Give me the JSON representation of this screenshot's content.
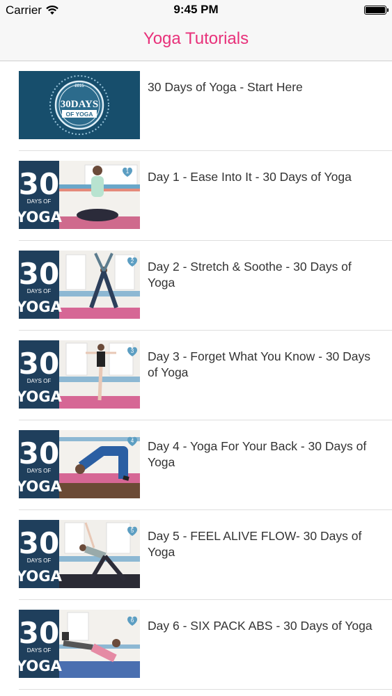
{
  "status_bar": {
    "carrier": "Carrier",
    "time": "9:45 PM"
  },
  "nav": {
    "title": "Yoga Tutorials"
  },
  "rows": [
    {
      "label": "30 Days of Yoga - Start Here",
      "thumbnail": {
        "kind": "badge",
        "badge_top": "30DAYS",
        "badge_bottom": "OF YOGA",
        "badge_year": "2015"
      }
    },
    {
      "label": "Day 1 - Ease Into It - 30 Days of Yoga",
      "thumbnail": {
        "kind": "day",
        "big": "30",
        "small": "DAYS OF",
        "word": "YOGA",
        "heart": "1"
      }
    },
    {
      "label": "Day 2 - Stretch & Soothe - 30 Days of Yoga",
      "thumbnail": {
        "kind": "day",
        "big": "30",
        "small": "DAYS OF",
        "word": "YOGA",
        "heart": "2"
      }
    },
    {
      "label": "Day 3 - Forget What You Know - 30 Days of Yoga",
      "thumbnail": {
        "kind": "day",
        "big": "30",
        "small": "DAYS OF",
        "word": "YOGA",
        "heart": "3"
      }
    },
    {
      "label": "Day 4 - Yoga For Your Back - 30 Days of Yoga",
      "thumbnail": {
        "kind": "day",
        "big": "30",
        "small": "DAYS OF",
        "word": "YOGA",
        "heart": "4"
      }
    },
    {
      "label": "Day 5 - FEEL ALIVE FLOW- 30 Days of Yoga",
      "thumbnail": {
        "kind": "day",
        "big": "30",
        "small": "DAYS OF",
        "word": "YOGA",
        "heart": "5"
      }
    },
    {
      "label": "Day 6 - SIX PACK ABS - 30 Days of Yoga",
      "thumbnail": {
        "kind": "day",
        "big": "30",
        "small": "DAYS OF",
        "word": "YOGA",
        "heart": "6"
      }
    }
  ],
  "colors": {
    "accent": "#e8317a",
    "panel": "#1f3f5c",
    "mat": "#d9608f",
    "badge_bg": "#2c6b8c"
  }
}
